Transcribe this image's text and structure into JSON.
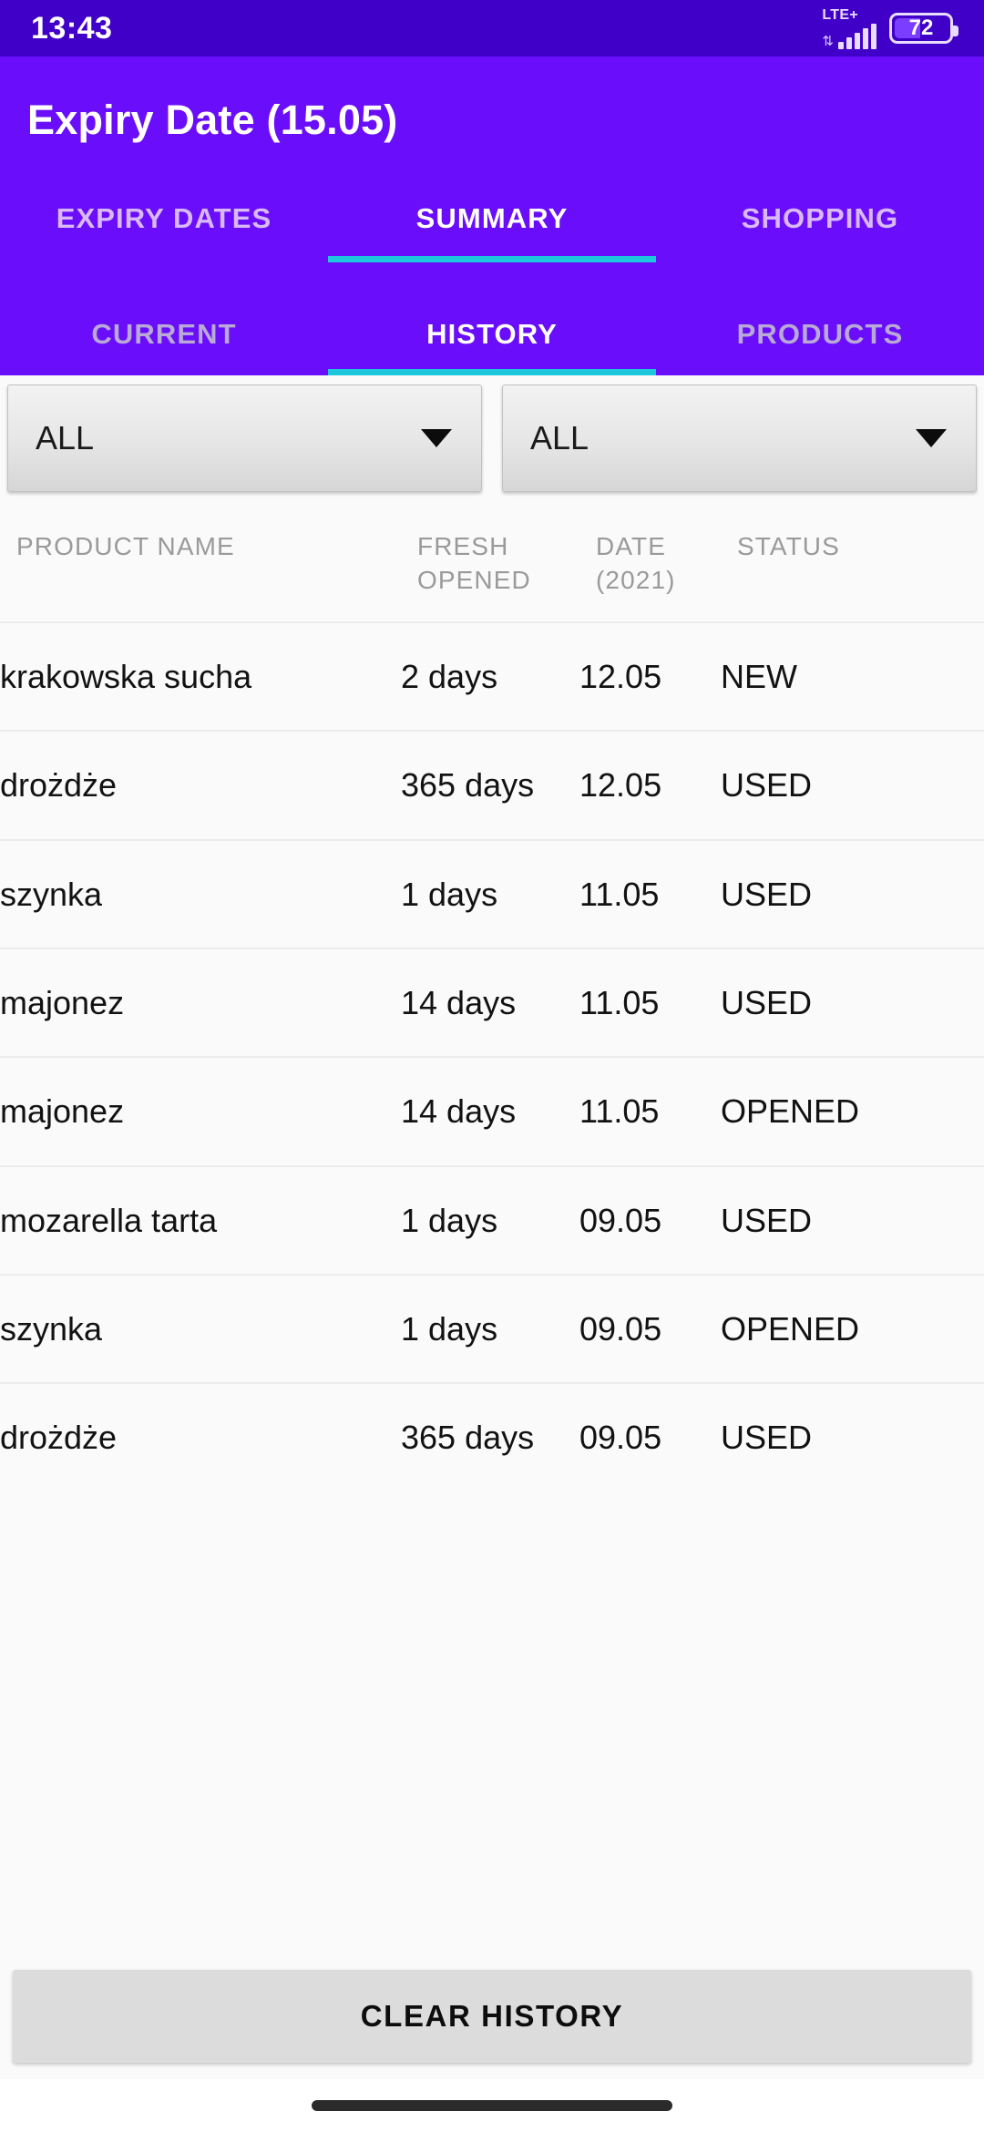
{
  "status_bar": {
    "clock": "13:43",
    "network_label": "LTE+",
    "network_arrows_icon": "up-down-arrows-icon",
    "signal_icon": "signal-bars-icon",
    "battery_icon": "battery-icon",
    "battery_percent": "72"
  },
  "app_bar": {
    "title": "Expiry Date (15.05)",
    "accent_color": "#6a0dfa",
    "indicator_color": "#1ec8dc",
    "primary_tabs": [
      {
        "label": "EXPIRY DATES",
        "active": false
      },
      {
        "label": "SUMMARY",
        "active": true
      },
      {
        "label": "SHOPPING",
        "active": false
      }
    ],
    "secondary_tabs": [
      {
        "label": "CURRENT",
        "active": false
      },
      {
        "label": "HISTORY",
        "active": true
      },
      {
        "label": "PRODUCTS",
        "active": false
      }
    ]
  },
  "filters": [
    {
      "name": "category-filter",
      "value": "ALL",
      "arrow_icon": "caret-down-icon"
    },
    {
      "name": "status-filter",
      "value": "ALL",
      "arrow_icon": "caret-down-icon"
    }
  ],
  "table": {
    "headers": {
      "product_name": "PRODUCT NAME",
      "fresh_opened_line1": "FRESH",
      "fresh_opened_line2": "OPENED",
      "date_line1": "DATE",
      "date_line2": "(2021)",
      "status": "STATUS"
    },
    "rows": [
      {
        "product_name": "krakowska sucha",
        "fresh_opened": "2 days",
        "date": "12.05",
        "status": "NEW"
      },
      {
        "product_name": "drożdże",
        "fresh_opened": "365 days",
        "date": "12.05",
        "status": "USED"
      },
      {
        "product_name": "szynka",
        "fresh_opened": "1 days",
        "date": "11.05",
        "status": "USED"
      },
      {
        "product_name": "majonez",
        "fresh_opened": "14 days",
        "date": "11.05",
        "status": "USED"
      },
      {
        "product_name": "majonez",
        "fresh_opened": "14 days",
        "date": "11.05",
        "status": "OPENED"
      },
      {
        "product_name": "mozarella tarta",
        "fresh_opened": "1 days",
        "date": "09.05",
        "status": "USED"
      },
      {
        "product_name": "szynka",
        "fresh_opened": "1 days",
        "date": "09.05",
        "status": "OPENED"
      },
      {
        "product_name": "drożdże",
        "fresh_opened": "365 days",
        "date": "09.05",
        "status": "USED"
      }
    ]
  },
  "footer": {
    "clear_button_label": "CLEAR HISTORY"
  }
}
